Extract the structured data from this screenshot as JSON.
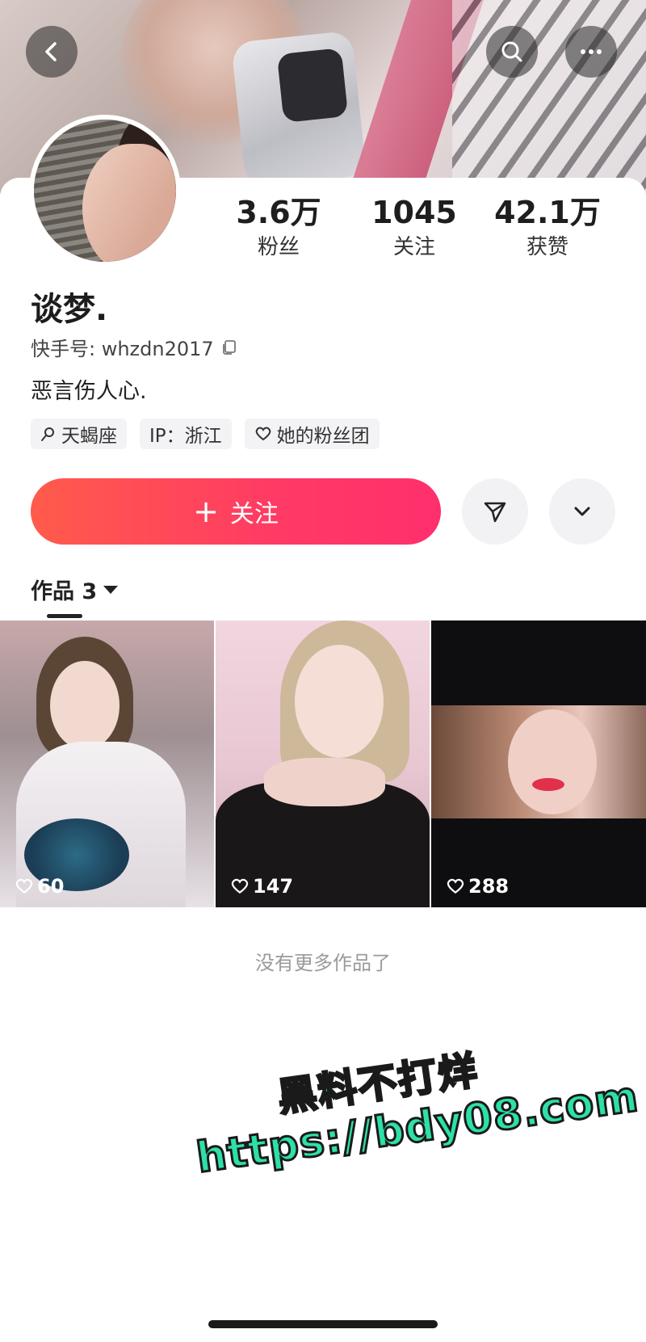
{
  "profile": {
    "name": "谈梦.",
    "kuaishou_id": "快手号: whzdn2017",
    "bio": "恶言伤人心."
  },
  "stats": [
    {
      "value": "3.6万",
      "label": "粉丝"
    },
    {
      "value": "1045",
      "label": "关注"
    },
    {
      "value": "42.1万",
      "label": "获赞"
    }
  ],
  "tags": [
    {
      "label": "天蝎座",
      "icon": "zodiac-icon"
    },
    {
      "label": "IP：浙江",
      "icon": ""
    },
    {
      "label": "她的粉丝团",
      "icon": "heart-outline-icon"
    }
  ],
  "actions": {
    "follow_label": "关注"
  },
  "works": {
    "tab_label": "作品 3",
    "items": [
      {
        "likes": "60"
      },
      {
        "likes": "147"
      },
      {
        "likes": "288"
      }
    ],
    "no_more": "没有更多作品了"
  },
  "watermark": {
    "line1": "黑料不打烊",
    "line2": "https://bdy08.com"
  },
  "colors": {
    "follow_gradient_start": "#ff5b4b",
    "follow_gradient_end": "#ff2f6d",
    "watermark_green": "#2de0a8"
  }
}
